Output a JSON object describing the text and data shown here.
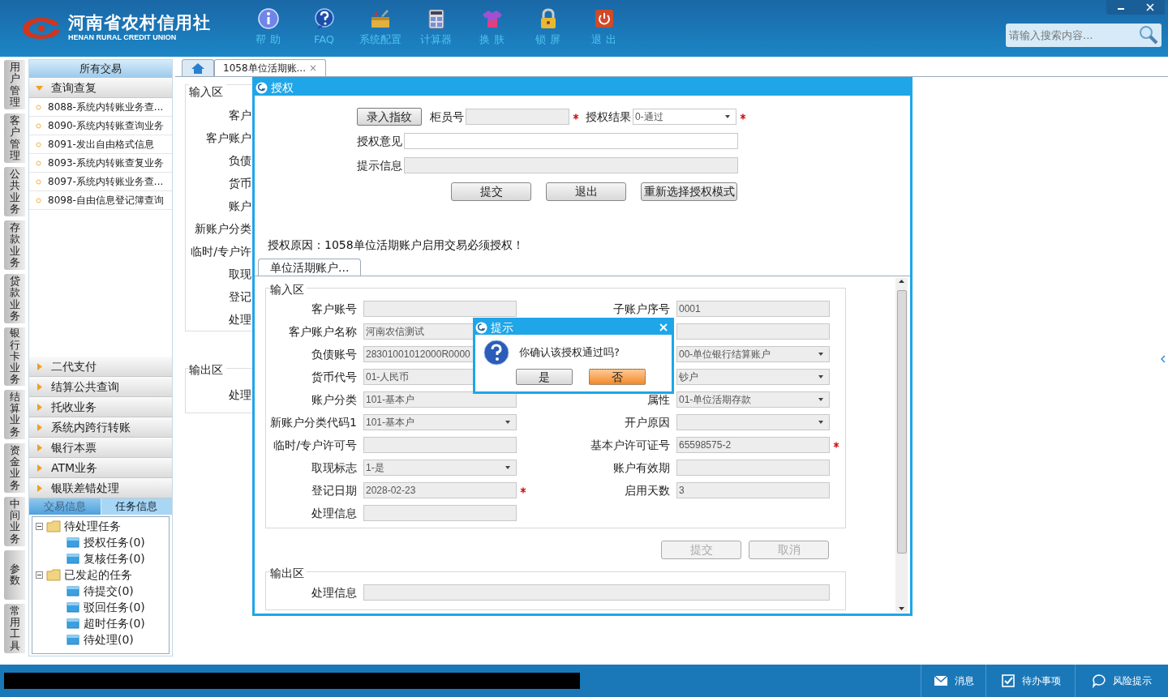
{
  "header": {
    "logo_title": "河南省农村信用社",
    "logo_subtitle": "HENAN RURAL CREDIT UNION",
    "toolbar": [
      {
        "kind": "help",
        "label": "帮 助"
      },
      {
        "kind": "faq",
        "label": "FAQ"
      },
      {
        "kind": "config",
        "label": "系统配置"
      },
      {
        "kind": "calculator",
        "label": "计算器"
      },
      {
        "kind": "skin",
        "label": "换 肤"
      },
      {
        "kind": "lock",
        "label": "锁 屏"
      },
      {
        "kind": "exit",
        "label": "退 出"
      }
    ],
    "search": {
      "placeholder": "请输入搜索内容..."
    }
  },
  "side_tabs": [
    "用户管理",
    "客户管理",
    "公共业务",
    "存款业务",
    "贷款业务",
    "银行卡业务",
    "结算业务",
    "资金业务",
    "中间业务",
    "参数",
    "常用工具"
  ],
  "nav": {
    "title": "所有交易",
    "groups": [
      {
        "label": "查询查复",
        "expanded": true,
        "items": [
          "8088-系统内转账业务查...",
          "8090-系统内转账查询业务",
          "8091-发出自由格式信息",
          "8093-系统内转账查复业务",
          "8097-系统内转账业务查...",
          "8098-自由信息登记簿查询"
        ]
      },
      {
        "label": "二代支付",
        "expanded": false
      },
      {
        "label": "结算公共查询",
        "expanded": false
      },
      {
        "label": "托收业务",
        "expanded": false
      },
      {
        "label": "系统内跨行转账",
        "expanded": false
      },
      {
        "label": "银行本票",
        "expanded": false
      },
      {
        "label": "ATM业务",
        "expanded": false
      },
      {
        "label": "银联差错处理",
        "expanded": false
      }
    ]
  },
  "info_tabs": [
    {
      "label": "交易信息",
      "selected": false
    },
    {
      "label": "任务信息",
      "selected": true
    }
  ],
  "task_tree": [
    {
      "label": "待处理任务",
      "expanded": true,
      "children": [
        {
          "label": "授权任务(0)"
        },
        {
          "label": "复核任务(0)"
        }
      ]
    },
    {
      "label": "已发起的任务",
      "expanded": true,
      "children": [
        {
          "label": "待提交(0)"
        },
        {
          "label": "驳回任务(0)"
        },
        {
          "label": "超时任务(0)"
        },
        {
          "label": "待处理(0)"
        }
      ]
    }
  ],
  "doc_tabs": [
    {
      "kind": "home",
      "selected": false
    },
    {
      "kind": "page",
      "label": "1058单位活期账...",
      "close": "×",
      "selected": true
    }
  ],
  "background_form": {
    "input_legend": "输入区",
    "labels": [
      "客户",
      "客户账户",
      "负债",
      "货币",
      "账户",
      "新账户分类",
      "临时/专户许",
      "取现",
      "登记",
      "处理"
    ],
    "output_legend": "输出区",
    "output_labels": [
      "处理"
    ]
  },
  "auth_dialog": {
    "title": "授权",
    "fingerprint_button": "录入指纹",
    "teller": {
      "label": "柜员号",
      "required": true
    },
    "result": {
      "label": "授权结果",
      "value": "0-通过",
      "required": true
    },
    "opinion": {
      "label": "授权意见",
      "readonly": false
    },
    "hint": {
      "label": "提示信息",
      "readonly": true
    },
    "buttons": [
      "提交",
      "退出",
      "重新选择授权模式"
    ],
    "reason": "授权原因：1058单位活期账户启用交易必须授权！",
    "subtab": {
      "label": "单位活期账户...",
      "selected": true
    },
    "input_legend": "输入区",
    "left_fields": [
      {
        "label": "客户账号",
        "kind": "text",
        "required": false
      },
      {
        "label": "客户账户名称",
        "kind": "text",
        "value": "河南农信测试",
        "required": false
      },
      {
        "label": "负债账号",
        "kind": "text",
        "value": "28301001012000R0000",
        "required": false
      },
      {
        "label": "货币代号",
        "kind": "text",
        "value": "01-人民币",
        "required": false
      },
      {
        "label": "账户分类",
        "kind": "text",
        "value": "101-基本户",
        "required": false
      },
      {
        "label": "新账户分类代码1",
        "kind": "select",
        "value": "101-基本户",
        "required": false
      },
      {
        "label": "临时/专户许可号",
        "kind": "text",
        "required": false
      },
      {
        "label": "取现标志",
        "kind": "select",
        "value": "1-是",
        "required": false
      },
      {
        "label": "登记日期",
        "kind": "text",
        "value": "2028-02-23",
        "required": true
      },
      {
        "label": "处理信息",
        "kind": "text",
        "required": false
      }
    ],
    "right_fields": [
      {
        "label": "子账户序号",
        "kind": "text",
        "value": "0001",
        "required": false
      },
      {
        "kind": "text",
        "required": false
      },
      {
        "kind": "select",
        "value": "00-单位银行结算账户",
        "required": false
      },
      {
        "kind": "select",
        "value": "钞户",
        "required": false
      },
      {
        "label": "属性",
        "kind": "select",
        "value": "01-单位活期存款",
        "required": false
      },
      {
        "label": "开户原因",
        "kind": "select",
        "required": false
      },
      {
        "label": "基本户许可证号",
        "kind": "text",
        "value": "65598575-2",
        "required": true
      },
      {
        "label": "账户有效期",
        "kind": "text",
        "required": false
      },
      {
        "label": "启用天数",
        "kind": "text",
        "value": "3",
        "required": false
      }
    ],
    "actions": [
      {
        "label": "提交",
        "disabled": true
      },
      {
        "label": "取消",
        "disabled": true
      }
    ],
    "output_legend": "输出区",
    "output_label": "处理信息"
  },
  "prompt": {
    "title": "提示",
    "message": "你确认该授权通过吗?",
    "buttons": [
      {
        "label": "是",
        "focused": false
      },
      {
        "label": "否",
        "focused": true
      }
    ]
  },
  "status_bar": [
    {
      "kind": "message",
      "label": "消息"
    },
    {
      "kind": "todo",
      "label": "待办事项"
    },
    {
      "kind": "risk",
      "label": "风险提示"
    }
  ]
}
